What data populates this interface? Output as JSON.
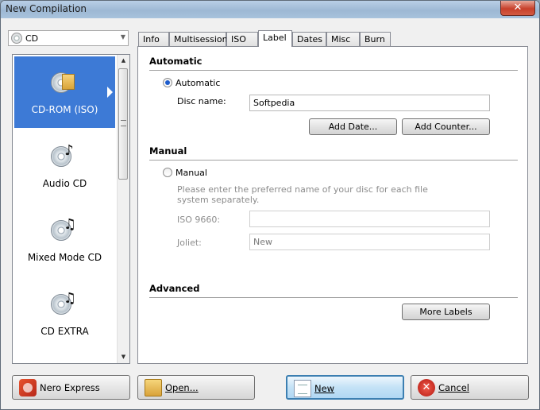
{
  "window": {
    "title": "New Compilation",
    "close_label": "✕"
  },
  "media_combo": {
    "value": "CD"
  },
  "compilation_types": [
    {
      "label": "CD-ROM (ISO)",
      "icon": "cd-rom-iso-icon",
      "selected": true
    },
    {
      "label": "Audio CD",
      "icon": "audio-cd-icon",
      "selected": false
    },
    {
      "label": "Mixed Mode CD",
      "icon": "mixed-mode-cd-icon",
      "selected": false
    },
    {
      "label": "CD EXTRA",
      "icon": "cd-extra-icon",
      "selected": false
    }
  ],
  "tabs": [
    {
      "label": "Info",
      "active": false
    },
    {
      "label": "Multisession",
      "active": false
    },
    {
      "label": "ISO",
      "active": false
    },
    {
      "label": "Label",
      "active": true
    },
    {
      "label": "Dates",
      "active": false
    },
    {
      "label": "Misc",
      "active": false
    },
    {
      "label": "Burn",
      "active": false
    }
  ],
  "label_tab": {
    "automatic_heading": "Automatic",
    "automatic_radio": "Automatic",
    "disc_name_label": "Disc name:",
    "disc_name_value": "Softpedia",
    "add_date_button": "Add Date...",
    "add_counter_button": "Add Counter...",
    "manual_heading": "Manual",
    "manual_radio": "Manual",
    "manual_hint": "Please enter the preferred name of your disc for each file system separately.",
    "iso9660_label": "ISO 9660:",
    "iso9660_value": "",
    "joliet_label": "Joliet:",
    "joliet_value": "New",
    "advanced_heading": "Advanced",
    "more_labels_button": "More Labels"
  },
  "footer": {
    "nero_express": "Nero Express",
    "open": "Open...",
    "new": "New",
    "cancel": "Cancel"
  },
  "colors": {
    "selection": "#3d7ad6",
    "title_bar": "#9db8d4",
    "close": "#c7402b"
  }
}
